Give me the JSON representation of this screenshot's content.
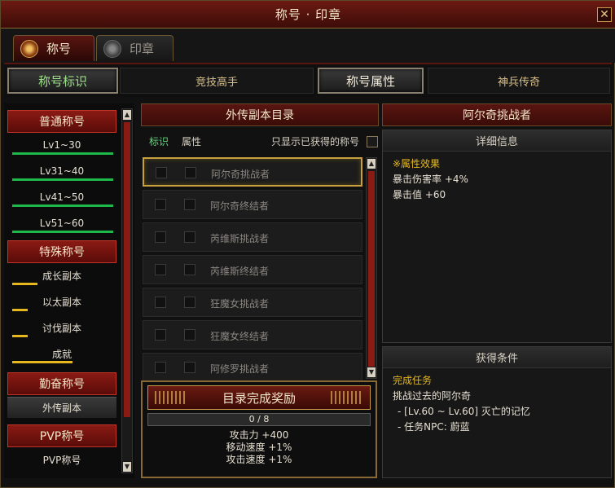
{
  "window": {
    "title": "称号 · 印章",
    "close_glyph": "✕"
  },
  "main_tabs": [
    {
      "label": "称号",
      "icon": "title-emblem-icon",
      "active": true
    },
    {
      "label": "印章",
      "icon": "seal-emblem-icon",
      "active": false
    }
  ],
  "sub_tabs": [
    {
      "label": "称号标识",
      "active": true
    },
    {
      "label": "竞技高手",
      "active": false
    },
    {
      "label": "称号属性",
      "active": true
    },
    {
      "label": "神兵传奇",
      "active": false
    }
  ],
  "sidebar": {
    "groups": [
      {
        "label": "普通称号",
        "items": [
          {
            "label": "Lv1~30"
          },
          {
            "label": "Lv31~40"
          },
          {
            "label": "Lv41~50"
          },
          {
            "label": "Lv51~60"
          }
        ]
      },
      {
        "label": "特殊称号",
        "items": [
          {
            "label": "成长副本",
            "progress": 0.25
          },
          {
            "label": "以太副本",
            "progress": 0.15
          },
          {
            "label": "讨伐副本",
            "progress": 0.15
          },
          {
            "label": "成就",
            "progress": 0.6
          }
        ]
      },
      {
        "label": "勤奋称号",
        "items": [
          {
            "label": "外传副本",
            "selected": true
          }
        ]
      },
      {
        "label": "PVP称号",
        "items": [
          {
            "label": "PVP称号"
          }
        ]
      }
    ]
  },
  "list": {
    "header": "外传副本目录",
    "col_mark": "标识",
    "col_attr": "属性",
    "show_only_label": "只显示已获得的称号",
    "rows": [
      {
        "name": "阿尔奇挑战者",
        "selected": true
      },
      {
        "name": "阿尔奇终结者"
      },
      {
        "name": "芮维斯挑战者"
      },
      {
        "name": "芮维斯终结者"
      },
      {
        "name": "狂魔女挑战者"
      },
      {
        "name": "狂魔女终结者"
      },
      {
        "name": "阿修罗挑战者"
      }
    ]
  },
  "reward": {
    "button_label": "目录完成奖励",
    "progress_text": "0 / 8",
    "progress_value": 0,
    "lines": [
      "攻击力 +400",
      "移动速度 +1%",
      "攻击速度 +1%"
    ]
  },
  "detail": {
    "title": "阿尔奇挑战者",
    "info_header": "详细信息",
    "attr_heading": "※属性效果",
    "attrs": [
      "暴击伤害率 +4%",
      "暴击值 +60"
    ],
    "cond_header": "获得条件",
    "cond_heading": "完成任务",
    "conds": [
      "挑战过去的阿尔奇",
      "- [Lv.60 ~ Lv.60] 灭亡的记忆",
      "- 任务NPC: 蔚蓝"
    ]
  },
  "colors": {
    "accent_red": "#8a1a14",
    "gold": "#c89a4a",
    "green_bar": "#1fb84a",
    "yellow_bar": "#e6b81e"
  }
}
